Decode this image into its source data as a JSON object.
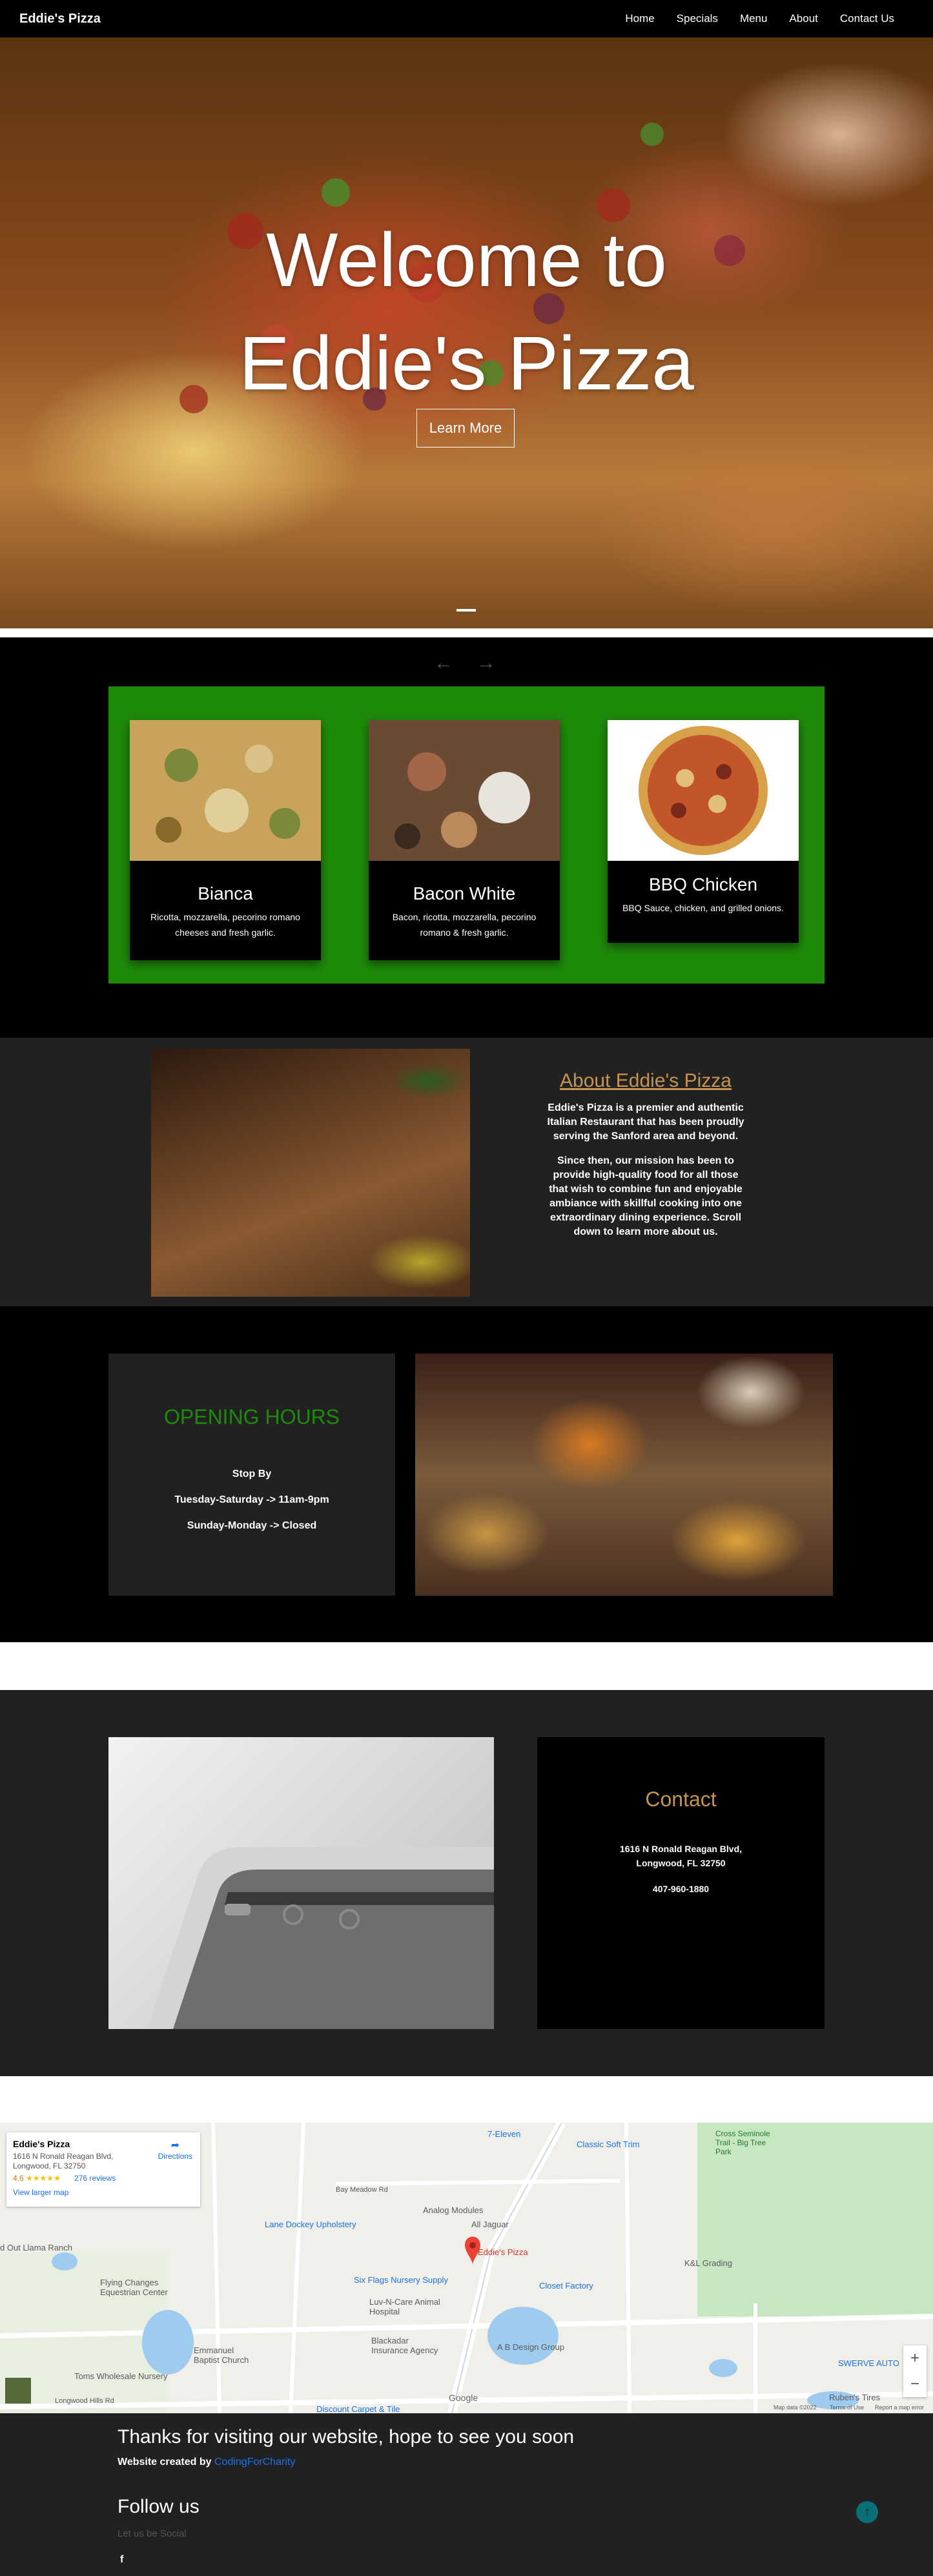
{
  "nav": {
    "brand": "Eddie's Pizza",
    "links": [
      "Home",
      "Specials",
      "Menu",
      "About",
      "Contact Us"
    ]
  },
  "hero": {
    "title_line1": "Welcome to",
    "title_line2": "Eddie's Pizza",
    "button": "Learn More"
  },
  "carousel": {
    "prev_icon": "←",
    "next_icon": "→",
    "cards": [
      {
        "title": "Bianca",
        "desc": "Ricotta, mozzarella, pecorino romano cheeses and fresh garlic."
      },
      {
        "title": "Bacon White",
        "desc": "Bacon, ricotta, mozzarella, pecorino romano & fresh garlic."
      },
      {
        "title": "BBQ Chicken",
        "desc": "BBQ Sauce, chicken, and grilled onions."
      }
    ]
  },
  "about": {
    "title": "About Eddie's Pizza",
    "para1": "Eddie's Pizza is a premier and authentic Italian Restaurant that has been proudly serving the Sanford area and beyond.",
    "para2": "Since then, our mission has been to provide high-quality food for all those that wish to combine fun and enjoyable ambiance with skillful cooking into one extraordinary dining experience. Scroll down to learn more about us."
  },
  "hours": {
    "title": "OPENING HOURS",
    "line1": "Stop By",
    "line2": "Tuesday-Saturday -> 11am-9pm",
    "line3": "Sunday-Monday -> Closed"
  },
  "contact": {
    "title": "Contact",
    "address1": "1616 N Ronald Reagan Blvd,",
    "address2": "Longwood, FL 32750",
    "phone": "407-960-1880"
  },
  "map": {
    "card_name": "Eddie's Pizza",
    "card_addr1": "1616 N Ronald Reagan Blvd,",
    "card_addr2": "Longwood, FL 32750",
    "rating": "4.6",
    "stars": "★★★★★",
    "reviews": "276 reviews",
    "larger": "View larger map",
    "directions": "Directions",
    "labels": {
      "seven_eleven": "7-Eleven",
      "classic_soft": "Classic Soft Trim",
      "seminole": "Cross Seminole Trail - Big Tree Park",
      "bay_meadow": "Bay Meadow Rd",
      "lane_dockey": "Lane Dockey Upholstery",
      "analog": "Analog Modules",
      "all_jaguar": "All Jaguar",
      "eddies": "Eddie's Pizza",
      "kl_grading": "K&L Grading",
      "six_flags": "Six Flags Nursery Supply",
      "luv_n_care": "Luv-N-Care Animal Hospital",
      "closet_factory": "Closet Factory",
      "blackadar": "Blackadar Insurance Agency",
      "ab_design": "A B Design Group",
      "flying_changes": "Flying Changes Equestrian Center",
      "emmanuel": "Emmanuel Baptist Church",
      "toms": "Toms Wholesale Nursery",
      "lime_ranch": "d Out Llama Ranch",
      "swerve": "SWERVE AUTO",
      "rubens": "Ruben's Tires",
      "discount_carpet": "Discount Carpet & Tile",
      "longwood_hills": "Longwood Hills Rd",
      "google": "Google",
      "map_data": "Map data ©2022",
      "terms": "Terms of Use",
      "report": "Report a map error"
    }
  },
  "footer": {
    "thanks": "Thanks for visiting our website, hope to see you soon",
    "credit_prefix": "Website created by ",
    "credit_link": "CodingForCharity",
    "follow": "Follow us",
    "social": "Let us be Social",
    "fb": "f",
    "top": "↑"
  }
}
